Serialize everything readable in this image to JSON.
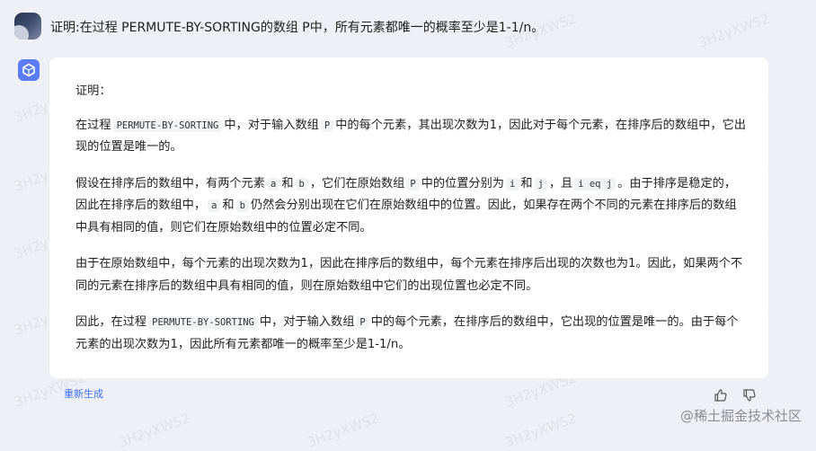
{
  "user_message": {
    "text": "证明:在过程 PERMUTE-BY-SORTING的数组 P中，所有元素都唯一的概率至少是1-1/n。"
  },
  "response": {
    "title": "证明：",
    "p1": {
      "a": "在过程",
      "code1": "PERMUTE-BY-SORTING",
      "b": "中，对于输入数组",
      "code2": "P",
      "c": "中的每个元素，其出现次数为1，因此对于每个元素，在排序后的数组中，它出现的位置是唯一的。"
    },
    "p2": {
      "a": "假设在排序后的数组中，有两个元素",
      "code_a": "a",
      "b": "和",
      "code_b": "b",
      "c": "，它们在原始数组",
      "code_p": "P",
      "d": "中的位置分别为",
      "code_i": "i",
      "e": "和",
      "code_j": "j",
      "f": "，且",
      "code_ieqj": "i eq j",
      "g": "。由于排序是稳定的，因此在排序后的数组中，",
      "code_a2": "a",
      "h": "和",
      "code_b2": "b",
      "i": "仍然会分别出现在它们在原始数组中的位置。因此，如果存在两个不同的元素在排序后的数组中具有相同的值，则它们在原始数组中的位置必定不同。"
    },
    "p3": "由于在原始数组中，每个元素的出现次数为1，因此在排序后的数组中，每个元素在排序后出现的次数也为1。因此，如果两个不同的元素在排序后的数组中具有相同的值，则在原始数组中它们的出现位置也必定不同。",
    "p4": {
      "a": "因此，在过程",
      "code1": "PERMUTE-BY-SORTING",
      "b": "中，对于输入数组",
      "code2": "P",
      "c": "中的每个元素，在排序后的数组中，它出现的位置是唯一的。由于每个元素的出现次数为1，因此所有元素都唯一的概率至少是1-1/n。"
    }
  },
  "actions": {
    "regenerate_label": "重新生成"
  },
  "watermark": {
    "text": "3H2yXWS2",
    "site": "@稀土掘金技术社区"
  },
  "colors": {
    "accent": "#3f6ff5",
    "bot_avatar": "#5b7cf7",
    "background": "#eef0f5",
    "card": "#ffffff"
  },
  "icons": {
    "bot_avatar": "cube-icon",
    "thumb_up": "thumb-up-icon",
    "thumb_down": "thumb-down-icon"
  }
}
